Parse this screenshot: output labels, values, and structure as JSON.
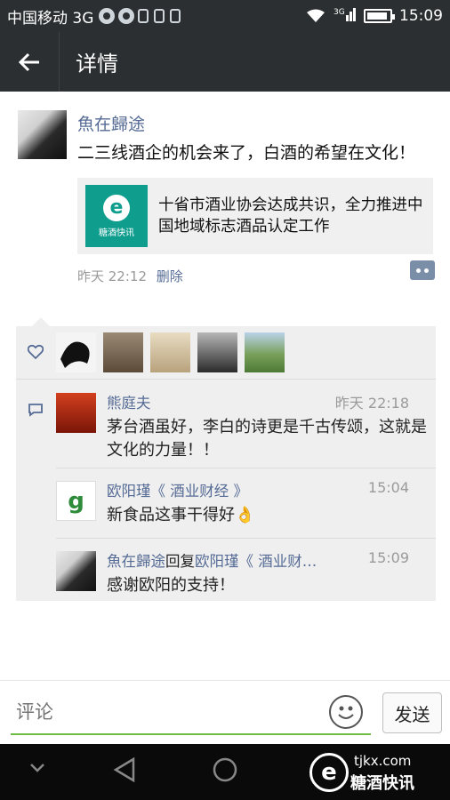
{
  "status_bar": {
    "carrier": "中国移动 3G",
    "network": "3G",
    "time": "15:09"
  },
  "header": {
    "title": "详情",
    "back_icon": "arrow-left-icon"
  },
  "post": {
    "author": "魚在歸途",
    "text": "二三线酒企的机会来了，白酒的希望在文化！",
    "link": {
      "logo_text": "糖酒快讯",
      "title": "十省市酒业协会达成共识，全力推进中国地域标志酒品认定工作"
    },
    "time": "昨天 22:12",
    "delete_label": "删除"
  },
  "likes": {
    "icon": "heart-icon",
    "count": 5
  },
  "comments": [
    {
      "name": "熊庭夫",
      "time": "昨天 22:18",
      "text": "茅台酒虽好，李白的诗更是千古传颂，这就是文化的力量！！"
    },
    {
      "name": "欧阳瑾《 酒业财经 》",
      "time": "15:04",
      "text": "新食品这事干得好👌"
    },
    {
      "name": "魚在歸途",
      "reply_word": "回复",
      "reply_to": "欧阳瑾《 酒业财…",
      "time": "15:09",
      "text": "感谢欧阳的支持！"
    }
  ],
  "input_bar": {
    "placeholder": "评论",
    "send_label": "发送",
    "emoji_icon": "smiley-icon"
  },
  "watermark": {
    "url": "tjkx.com",
    "brand": "糖酒快讯"
  },
  "colors": {
    "bar": "#2b2f31",
    "name_link": "#556b95",
    "input_underline": "#6bbd46",
    "panel": "#efefef"
  }
}
